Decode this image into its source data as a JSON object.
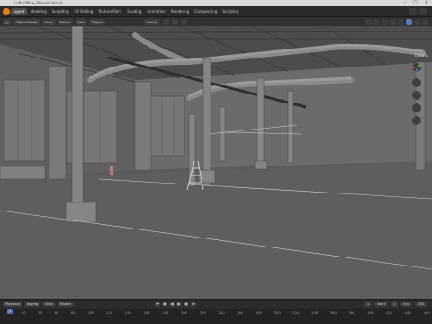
{
  "window": {
    "title": "Loft_Office_Blender.blend"
  },
  "workspace_tabs": [
    {
      "label": "Layout",
      "active": true
    },
    {
      "label": "Modeling",
      "active": false
    },
    {
      "label": "Sculpting",
      "active": false
    },
    {
      "label": "UV Editing",
      "active": false
    },
    {
      "label": "Texture Paint",
      "active": false
    },
    {
      "label": "Shading",
      "active": false
    },
    {
      "label": "Animation",
      "active": false
    },
    {
      "label": "Rendering",
      "active": false
    },
    {
      "label": "Compositing",
      "active": false
    },
    {
      "label": "Scripting",
      "active": false
    }
  ],
  "viewport_header": {
    "mode": "Object Mode",
    "view": "View",
    "select": "Select",
    "add": "Add",
    "object": "Object",
    "orientation": "Global",
    "options": "Options"
  },
  "timeline": {
    "playback": "Playback",
    "keying": "Keying",
    "view": "View",
    "marker": "Marker",
    "current_frame": "1",
    "start_label": "Start",
    "start": "1",
    "end_label": "End",
    "end": "250",
    "ruler_ticks": [
      "1",
      "20",
      "40",
      "60",
      "80",
      "100",
      "120",
      "140",
      "160",
      "180",
      "200",
      "220",
      "240",
      "260",
      "280",
      "300",
      "320",
      "340",
      "360",
      "380",
      "400",
      "420",
      "440",
      "460"
    ]
  },
  "colors": {
    "accent": "#e87d0d",
    "selection_blue": "#4a72c4"
  }
}
